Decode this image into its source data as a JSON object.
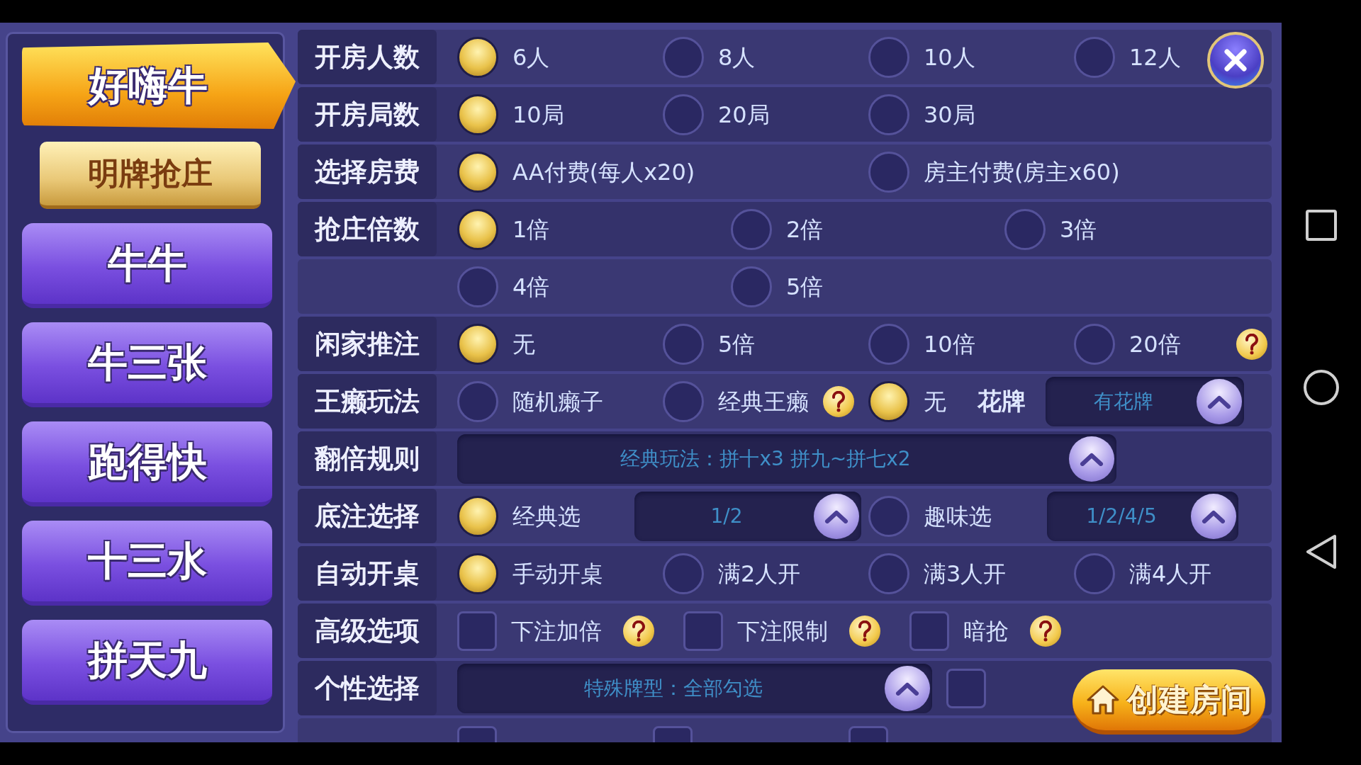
{
  "sidebar": {
    "games": [
      {
        "label": "好嗨牛",
        "selected": true,
        "children": [
          {
            "label": "明牌抢庄",
            "selected": true
          }
        ]
      },
      {
        "label": "牛牛",
        "selected": false
      },
      {
        "label": "牛三张",
        "selected": false
      },
      {
        "label": "跑得快",
        "selected": false
      },
      {
        "label": "十三水",
        "selected": false
      },
      {
        "label": "拼天九",
        "selected": false
      }
    ]
  },
  "rows": [
    {
      "kind": "quarters",
      "label": "开房人数",
      "items": [
        {
          "kind": "radio",
          "label": "6人",
          "selected": true
        },
        {
          "kind": "radio",
          "label": "8人",
          "selected": false
        },
        {
          "kind": "radio",
          "label": "10人",
          "selected": false
        },
        {
          "kind": "radio",
          "label": "12人",
          "selected": false
        }
      ]
    },
    {
      "kind": "quarters",
      "label": "开房局数",
      "items": [
        {
          "kind": "radio",
          "label": "10局",
          "selected": true
        },
        {
          "kind": "radio",
          "label": "20局",
          "selected": false
        },
        {
          "kind": "radio",
          "label": "30局",
          "selected": false
        }
      ]
    },
    {
      "kind": "halves",
      "label": "选择房费",
      "items": [
        {
          "kind": "radio",
          "label": "AA付费(每人x20)",
          "selected": true
        },
        {
          "kind": "radio",
          "label": "房主付费(房主x60)",
          "selected": false
        }
      ]
    },
    {
      "kind": "thirds",
      "label": "抢庄倍数",
      "items": [
        {
          "kind": "radio",
          "label": "1倍",
          "selected": true
        },
        {
          "kind": "radio",
          "label": "2倍",
          "selected": false
        },
        {
          "kind": "radio",
          "label": "3倍",
          "selected": false
        }
      ]
    },
    {
      "kind": "thirds",
      "items": [
        {
          "kind": "radio",
          "label": "4倍",
          "selected": false
        },
        {
          "kind": "radio",
          "label": "5倍",
          "selected": false
        }
      ]
    },
    {
      "kind": "quarters",
      "label": "闲家推注",
      "help": true,
      "items": [
        {
          "kind": "radio",
          "label": "无",
          "selected": true
        },
        {
          "kind": "radio",
          "label": "5倍",
          "selected": false
        },
        {
          "kind": "radio",
          "label": "10倍",
          "selected": false
        },
        {
          "kind": "radio",
          "label": "20倍",
          "selected": false
        }
      ]
    },
    {
      "kind": "laizi",
      "label": "王癞玩法",
      "items": [
        {
          "kind": "radio",
          "label": "随机癞子",
          "selected": false
        },
        {
          "kind": "radio",
          "label": "经典王癞",
          "selected": false,
          "help": true
        },
        {
          "kind": "radio",
          "label": "无",
          "selected": true
        },
        {
          "kind": "text",
          "label": "花牌"
        },
        {
          "kind": "dropdown",
          "value": "有花牌"
        }
      ]
    },
    {
      "kind": "rule",
      "label": "翻倍规则",
      "items": [
        {
          "kind": "dropdown",
          "value": "经典玩法：拼十x3 拼九~拼七x2"
        }
      ]
    },
    {
      "kind": "base",
      "label": "底注选择",
      "items": [
        {
          "kind": "radio",
          "label": "经典选",
          "selected": true
        },
        {
          "kind": "dropdown",
          "value": "1/2"
        },
        {
          "kind": "radio",
          "label": "趣味选",
          "selected": false
        },
        {
          "kind": "dropdown",
          "value": "1/2/4/5"
        }
      ]
    },
    {
      "kind": "quarters",
      "label": "自动开桌",
      "items": [
        {
          "kind": "radio",
          "label": "手动开桌",
          "selected": true
        },
        {
          "kind": "radio",
          "label": "满2人开",
          "selected": false
        },
        {
          "kind": "radio",
          "label": "满3人开",
          "selected": false
        },
        {
          "kind": "radio",
          "label": "满4人开",
          "selected": false
        }
      ]
    },
    {
      "kind": "advanced",
      "label": "高级选项",
      "items": [
        {
          "kind": "checkbox",
          "label": "下注加倍",
          "checked": false,
          "help": true
        },
        {
          "kind": "checkbox",
          "label": "下注限制",
          "checked": false,
          "help": true
        },
        {
          "kind": "checkbox",
          "label": "暗抢",
          "checked": false,
          "help": true
        }
      ]
    },
    {
      "kind": "custom",
      "label": "个性选择",
      "items": [
        {
          "kind": "dropdown",
          "value": "特殊牌型：全部勾选"
        },
        {
          "kind": "checkbox",
          "checked": false
        }
      ]
    },
    {
      "kind": "partial",
      "items": [
        {
          "kind": "checkbox",
          "checked": false
        },
        {
          "kind": "checkbox",
          "checked": false
        },
        {
          "kind": "checkbox",
          "checked": false
        }
      ]
    }
  ],
  "create_button": {
    "label": "创建房间"
  }
}
